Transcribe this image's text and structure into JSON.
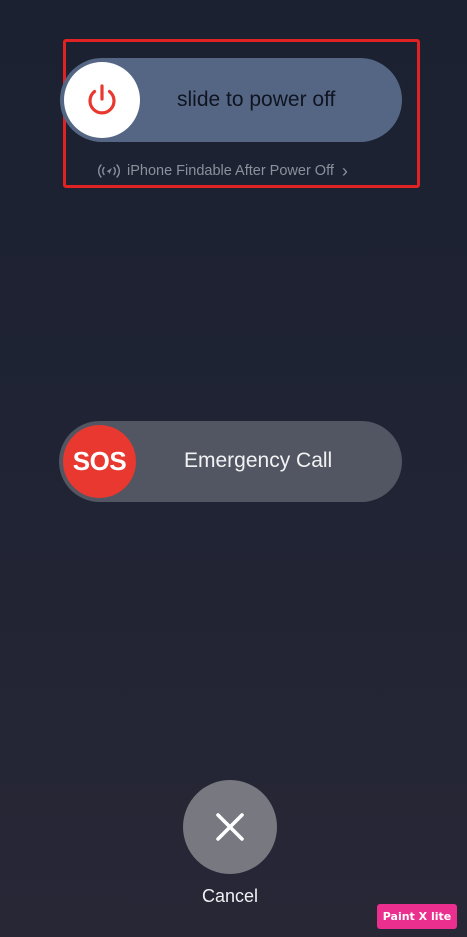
{
  "power_slider": {
    "label": "slide to power off",
    "knob_icon": "power-icon",
    "knob_icon_color": "#e8382f",
    "track_color": "#556685"
  },
  "findable": {
    "label": "iPhone Findable After Power Off",
    "icon": "find-my-location-icon",
    "chevron": "›"
  },
  "sos_slider": {
    "knob_label": "SOS",
    "label": "Emergency Call",
    "knob_color": "#e8382f"
  },
  "cancel": {
    "icon": "close-icon",
    "label": "Cancel"
  },
  "watermark": {
    "text": "Paint X lite",
    "color": "#ea2f8e"
  },
  "annotation": {
    "color": "#e02222"
  }
}
